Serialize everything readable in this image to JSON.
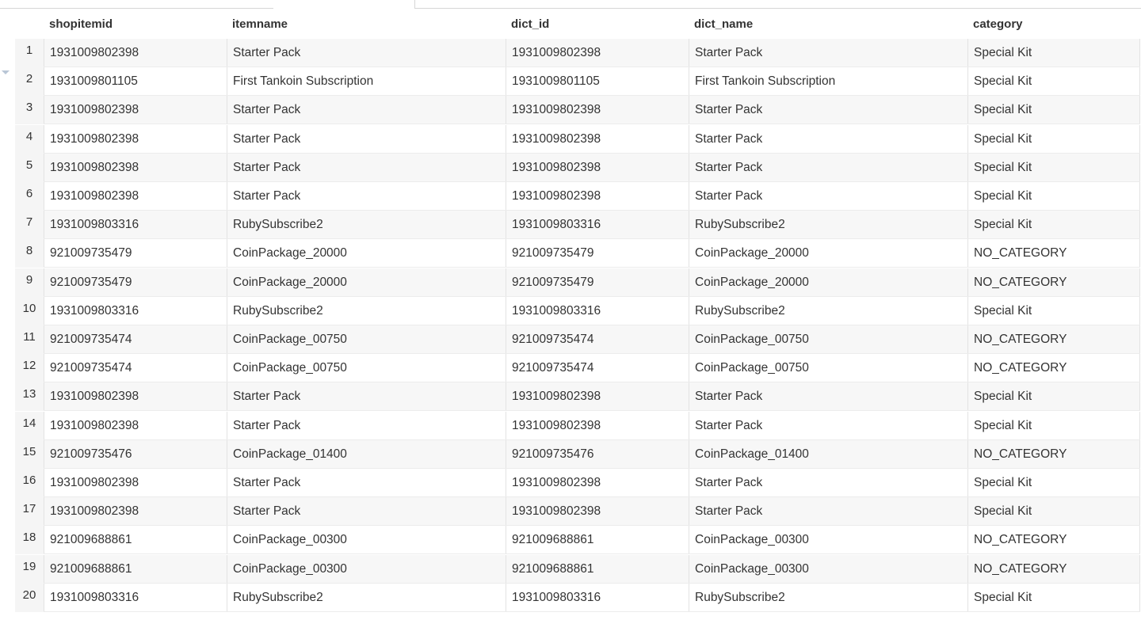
{
  "columns": [
    "shopitemid",
    "itemname",
    "dict_id",
    "dict_name",
    "category"
  ],
  "rows": [
    {
      "n": "1",
      "shopitemid": "1931009802398",
      "itemname": "Starter Pack",
      "dict_id": "1931009802398",
      "dict_name": "Starter Pack",
      "category": "Special Kit"
    },
    {
      "n": "2",
      "shopitemid": "1931009801105",
      "itemname": "First Tankoin Subscription",
      "dict_id": "1931009801105",
      "dict_name": "First Tankoin Subscription",
      "category": "Special Kit"
    },
    {
      "n": "3",
      "shopitemid": "1931009802398",
      "itemname": "Starter Pack",
      "dict_id": "1931009802398",
      "dict_name": "Starter Pack",
      "category": "Special Kit"
    },
    {
      "n": "4",
      "shopitemid": "1931009802398",
      "itemname": "Starter Pack",
      "dict_id": "1931009802398",
      "dict_name": "Starter Pack",
      "category": "Special Kit"
    },
    {
      "n": "5",
      "shopitemid": "1931009802398",
      "itemname": "Starter Pack",
      "dict_id": "1931009802398",
      "dict_name": "Starter Pack",
      "category": "Special Kit"
    },
    {
      "n": "6",
      "shopitemid": "1931009802398",
      "itemname": "Starter Pack",
      "dict_id": "1931009802398",
      "dict_name": "Starter Pack",
      "category": "Special Kit"
    },
    {
      "n": "7",
      "shopitemid": "1931009803316",
      "itemname": "RubySubscribe2",
      "dict_id": "1931009803316",
      "dict_name": "RubySubscribe2",
      "category": "Special Kit"
    },
    {
      "n": "8",
      "shopitemid": "921009735479",
      "itemname": "CoinPackage_20000",
      "dict_id": "921009735479",
      "dict_name": "CoinPackage_20000",
      "category": "NO_CATEGORY"
    },
    {
      "n": "9",
      "shopitemid": "921009735479",
      "itemname": "CoinPackage_20000",
      "dict_id": "921009735479",
      "dict_name": "CoinPackage_20000",
      "category": "NO_CATEGORY"
    },
    {
      "n": "10",
      "shopitemid": "1931009803316",
      "itemname": "RubySubscribe2",
      "dict_id": "1931009803316",
      "dict_name": "RubySubscribe2",
      "category": "Special Kit"
    },
    {
      "n": "11",
      "shopitemid": "921009735474",
      "itemname": "CoinPackage_00750",
      "dict_id": "921009735474",
      "dict_name": "CoinPackage_00750",
      "category": "NO_CATEGORY"
    },
    {
      "n": "12",
      "shopitemid": "921009735474",
      "itemname": "CoinPackage_00750",
      "dict_id": "921009735474",
      "dict_name": "CoinPackage_00750",
      "category": "NO_CATEGORY"
    },
    {
      "n": "13",
      "shopitemid": "1931009802398",
      "itemname": "Starter Pack",
      "dict_id": "1931009802398",
      "dict_name": "Starter Pack",
      "category": "Special Kit"
    },
    {
      "n": "14",
      "shopitemid": "1931009802398",
      "itemname": "Starter Pack",
      "dict_id": "1931009802398",
      "dict_name": "Starter Pack",
      "category": "Special Kit"
    },
    {
      "n": "15",
      "shopitemid": "921009735476",
      "itemname": "CoinPackage_01400",
      "dict_id": "921009735476",
      "dict_name": "CoinPackage_01400",
      "category": "NO_CATEGORY"
    },
    {
      "n": "16",
      "shopitemid": "1931009802398",
      "itemname": "Starter Pack",
      "dict_id": "1931009802398",
      "dict_name": "Starter Pack",
      "category": "Special Kit"
    },
    {
      "n": "17",
      "shopitemid": "1931009802398",
      "itemname": "Starter Pack",
      "dict_id": "1931009802398",
      "dict_name": "Starter Pack",
      "category": "Special Kit"
    },
    {
      "n": "18",
      "shopitemid": "921009688861",
      "itemname": "CoinPackage_00300",
      "dict_id": "921009688861",
      "dict_name": "CoinPackage_00300",
      "category": "NO_CATEGORY"
    },
    {
      "n": "19",
      "shopitemid": "921009688861",
      "itemname": "CoinPackage_00300",
      "dict_id": "921009688861",
      "dict_name": "CoinPackage_00300",
      "category": "NO_CATEGORY"
    },
    {
      "n": "20",
      "shopitemid": "1931009803316",
      "itemname": "RubySubscribe2",
      "dict_id": "1931009803316",
      "dict_name": "RubySubscribe2",
      "category": "Special Kit"
    }
  ]
}
